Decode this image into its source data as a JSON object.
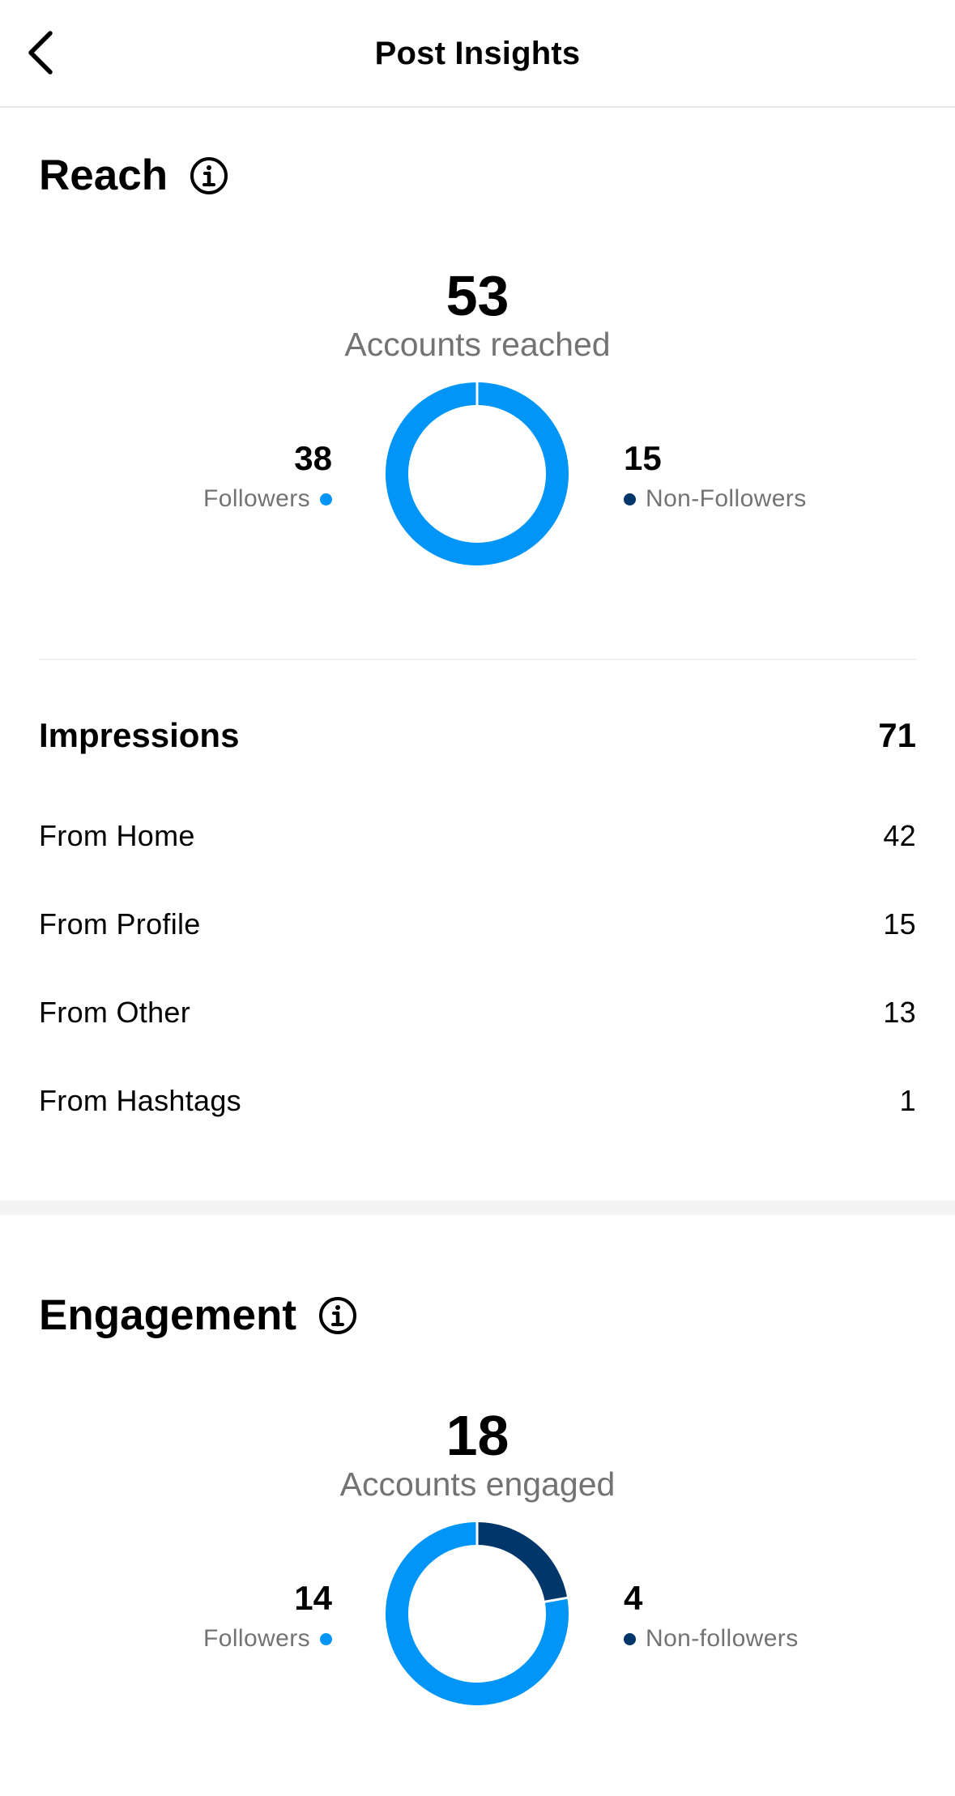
{
  "header": {
    "title": "Post Insights",
    "back_icon": "chevron-left-icon"
  },
  "colors": {
    "followers": "#0095f6",
    "non_followers": "#00376b",
    "muted": "#737373"
  },
  "reach": {
    "title": "Reach",
    "total": "53",
    "total_label": "Accounts reached",
    "followers": {
      "value": "38",
      "label": "Followers"
    },
    "non_followers": {
      "value": "15",
      "label": "Non-Followers"
    }
  },
  "impressions": {
    "label": "Impressions",
    "value": "71",
    "rows": [
      {
        "label": "From Home",
        "value": "42"
      },
      {
        "label": "From Profile",
        "value": "15"
      },
      {
        "label": "From Other",
        "value": "13"
      },
      {
        "label": "From Hashtags",
        "value": "1"
      }
    ]
  },
  "engagement": {
    "title": "Engagement",
    "total": "18",
    "total_label": "Accounts engaged",
    "followers": {
      "value": "14",
      "label": "Followers"
    },
    "non_followers": {
      "value": "4",
      "label": "Non-followers"
    }
  }
}
